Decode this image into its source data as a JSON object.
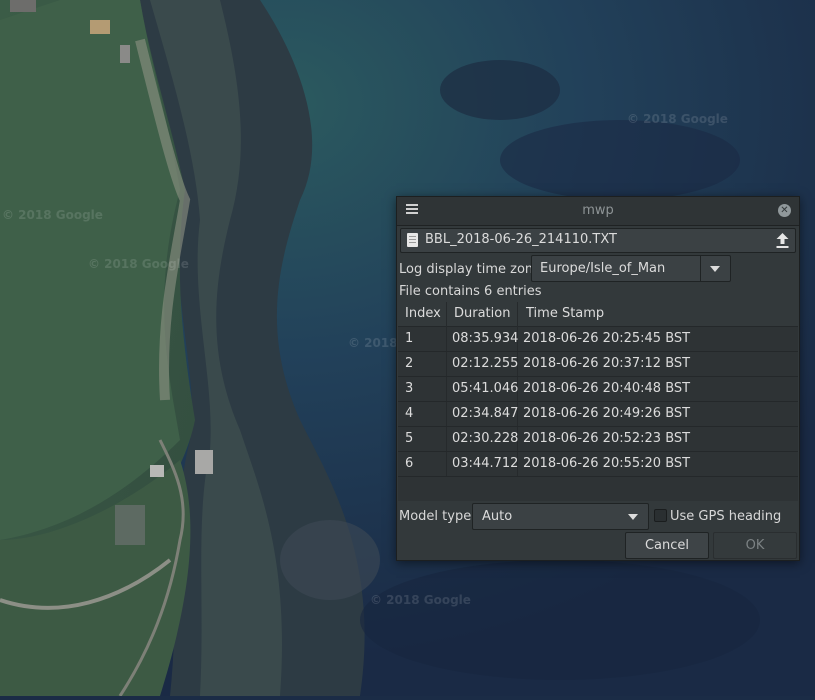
{
  "window": {
    "title": "mwp"
  },
  "file": {
    "name": "BBL_2018-06-26_214110.TXT"
  },
  "timezone": {
    "label": "Log display time zone",
    "value": "Europe/Isle_of_Man"
  },
  "entries_text": "File contains 6 entries",
  "table": {
    "headers": [
      "Index",
      "Duration",
      "Time Stamp"
    ],
    "rows": [
      [
        "1",
        "08:35.934",
        "2018-06-26 20:25:45 BST"
      ],
      [
        "2",
        "02:12.255",
        "2018-06-26 20:37:12 BST"
      ],
      [
        "3",
        "05:41.046",
        "2018-06-26 20:40:48 BST"
      ],
      [
        "4",
        "02:34.847",
        "2018-06-26 20:49:26 BST"
      ],
      [
        "5",
        "02:30.228",
        "2018-06-26 20:52:23 BST"
      ],
      [
        "6",
        "03:44.712",
        "2018-06-26 20:55:20 BST"
      ]
    ]
  },
  "model": {
    "label": "Model type:",
    "value": "Auto"
  },
  "gps": {
    "label": "Use GPS heading",
    "checked": false
  },
  "buttons": {
    "cancel": "Cancel",
    "ok": "OK"
  },
  "map": {
    "watermark": "© 2018 Google"
  },
  "icons": {
    "menu": "hamburger-menu-icon",
    "close": "close-icon",
    "file": "document-icon",
    "upload": "upload-icon",
    "dropdown": "chevron-down-icon"
  },
  "colors": {
    "dialog_bg": "#33393b",
    "map_sea": "#1b2c46",
    "map_land": "#2f4a3a"
  }
}
